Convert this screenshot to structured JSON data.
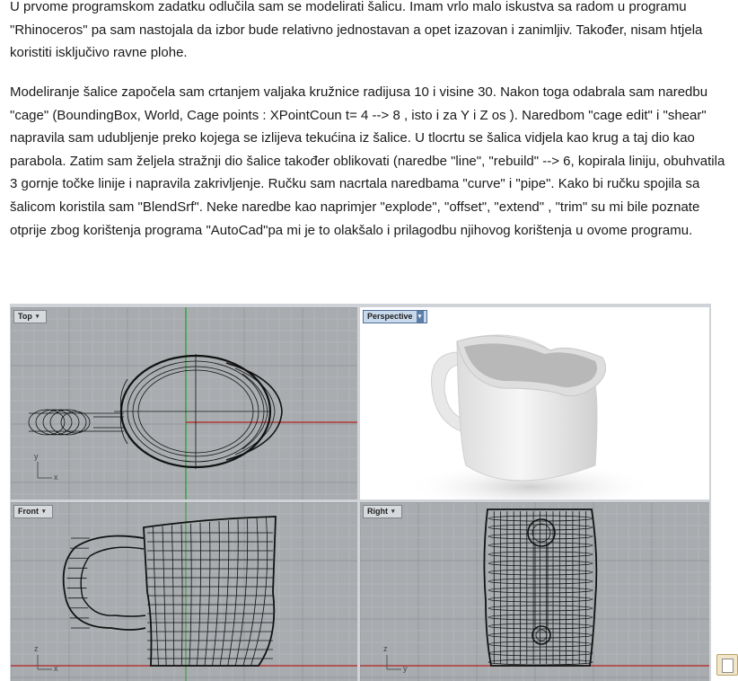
{
  "paragraphs": [
    "U prvome programskom zadatku odlučila sam se modelirati šalicu. Imam vrlo malo iskustva sa radom u programu \"Rhinoceros\" pa sam nastojala da izbor bude relativno jednostavan a opet izazovan i zanimljiv. Također, nisam htjela koristiti isključivo ravne plohe.",
    "Modeliranje šalice započela sam crtanjem valjaka kružnice radijusa 10 i visine 30. Nakon toga odabrala sam naredbu \"cage\" (BoundingBox, World, Cage points : XPointCoun t= 4 --> 8 , isto i za Y i Z os ). Naredbom \"cage edit\" i \"shear\" napravila sam udubljenje preko kojega se izlijeva tekućina iz šalice. U tlocrtu se šalica vidjela kao krug a taj dio kao parabola. Zatim sam željela stražnji dio šalice također oblikovati (naredbe \"line\", \"rebuild\" --> 6, kopirala liniju, obuhvatila 3 gornje točke linije i napravila zakrivljenje. Ručku sam nacrtala naredbama \"curve\" i \"pipe\". Kako bi ručku spojila sa šalicom koristila sam \"BlendSrf\". Neke naredbe kao naprimjer \"explode\", \"offset\", \"extend\" , \"trim\" su mi bile poznate otprije zbog korištenja programa \"AutoCad\"pa mi je to olakšalo i prilagodbu njihovog korištenja u ovome programu."
  ],
  "viewports": {
    "top": {
      "label": "Top",
      "dropdown": "▾",
      "axis_y": "y",
      "axis_x": "x"
    },
    "perspective": {
      "label": "Perspective",
      "dropdown": "▾"
    },
    "front": {
      "label": "Front",
      "dropdown": "▾",
      "axis_y": "z",
      "axis_x": "x"
    },
    "right": {
      "label": "Right",
      "dropdown": "▾",
      "axis_y": "z",
      "axis_x": "y"
    }
  },
  "colors": {
    "viewport_bg": "#a8acaf",
    "grid_minor": "#b6b9bc",
    "grid_major": "#8f9397",
    "axis_x": "#b22222",
    "axis_y": "#1e9e2e",
    "wire": "#111111"
  }
}
